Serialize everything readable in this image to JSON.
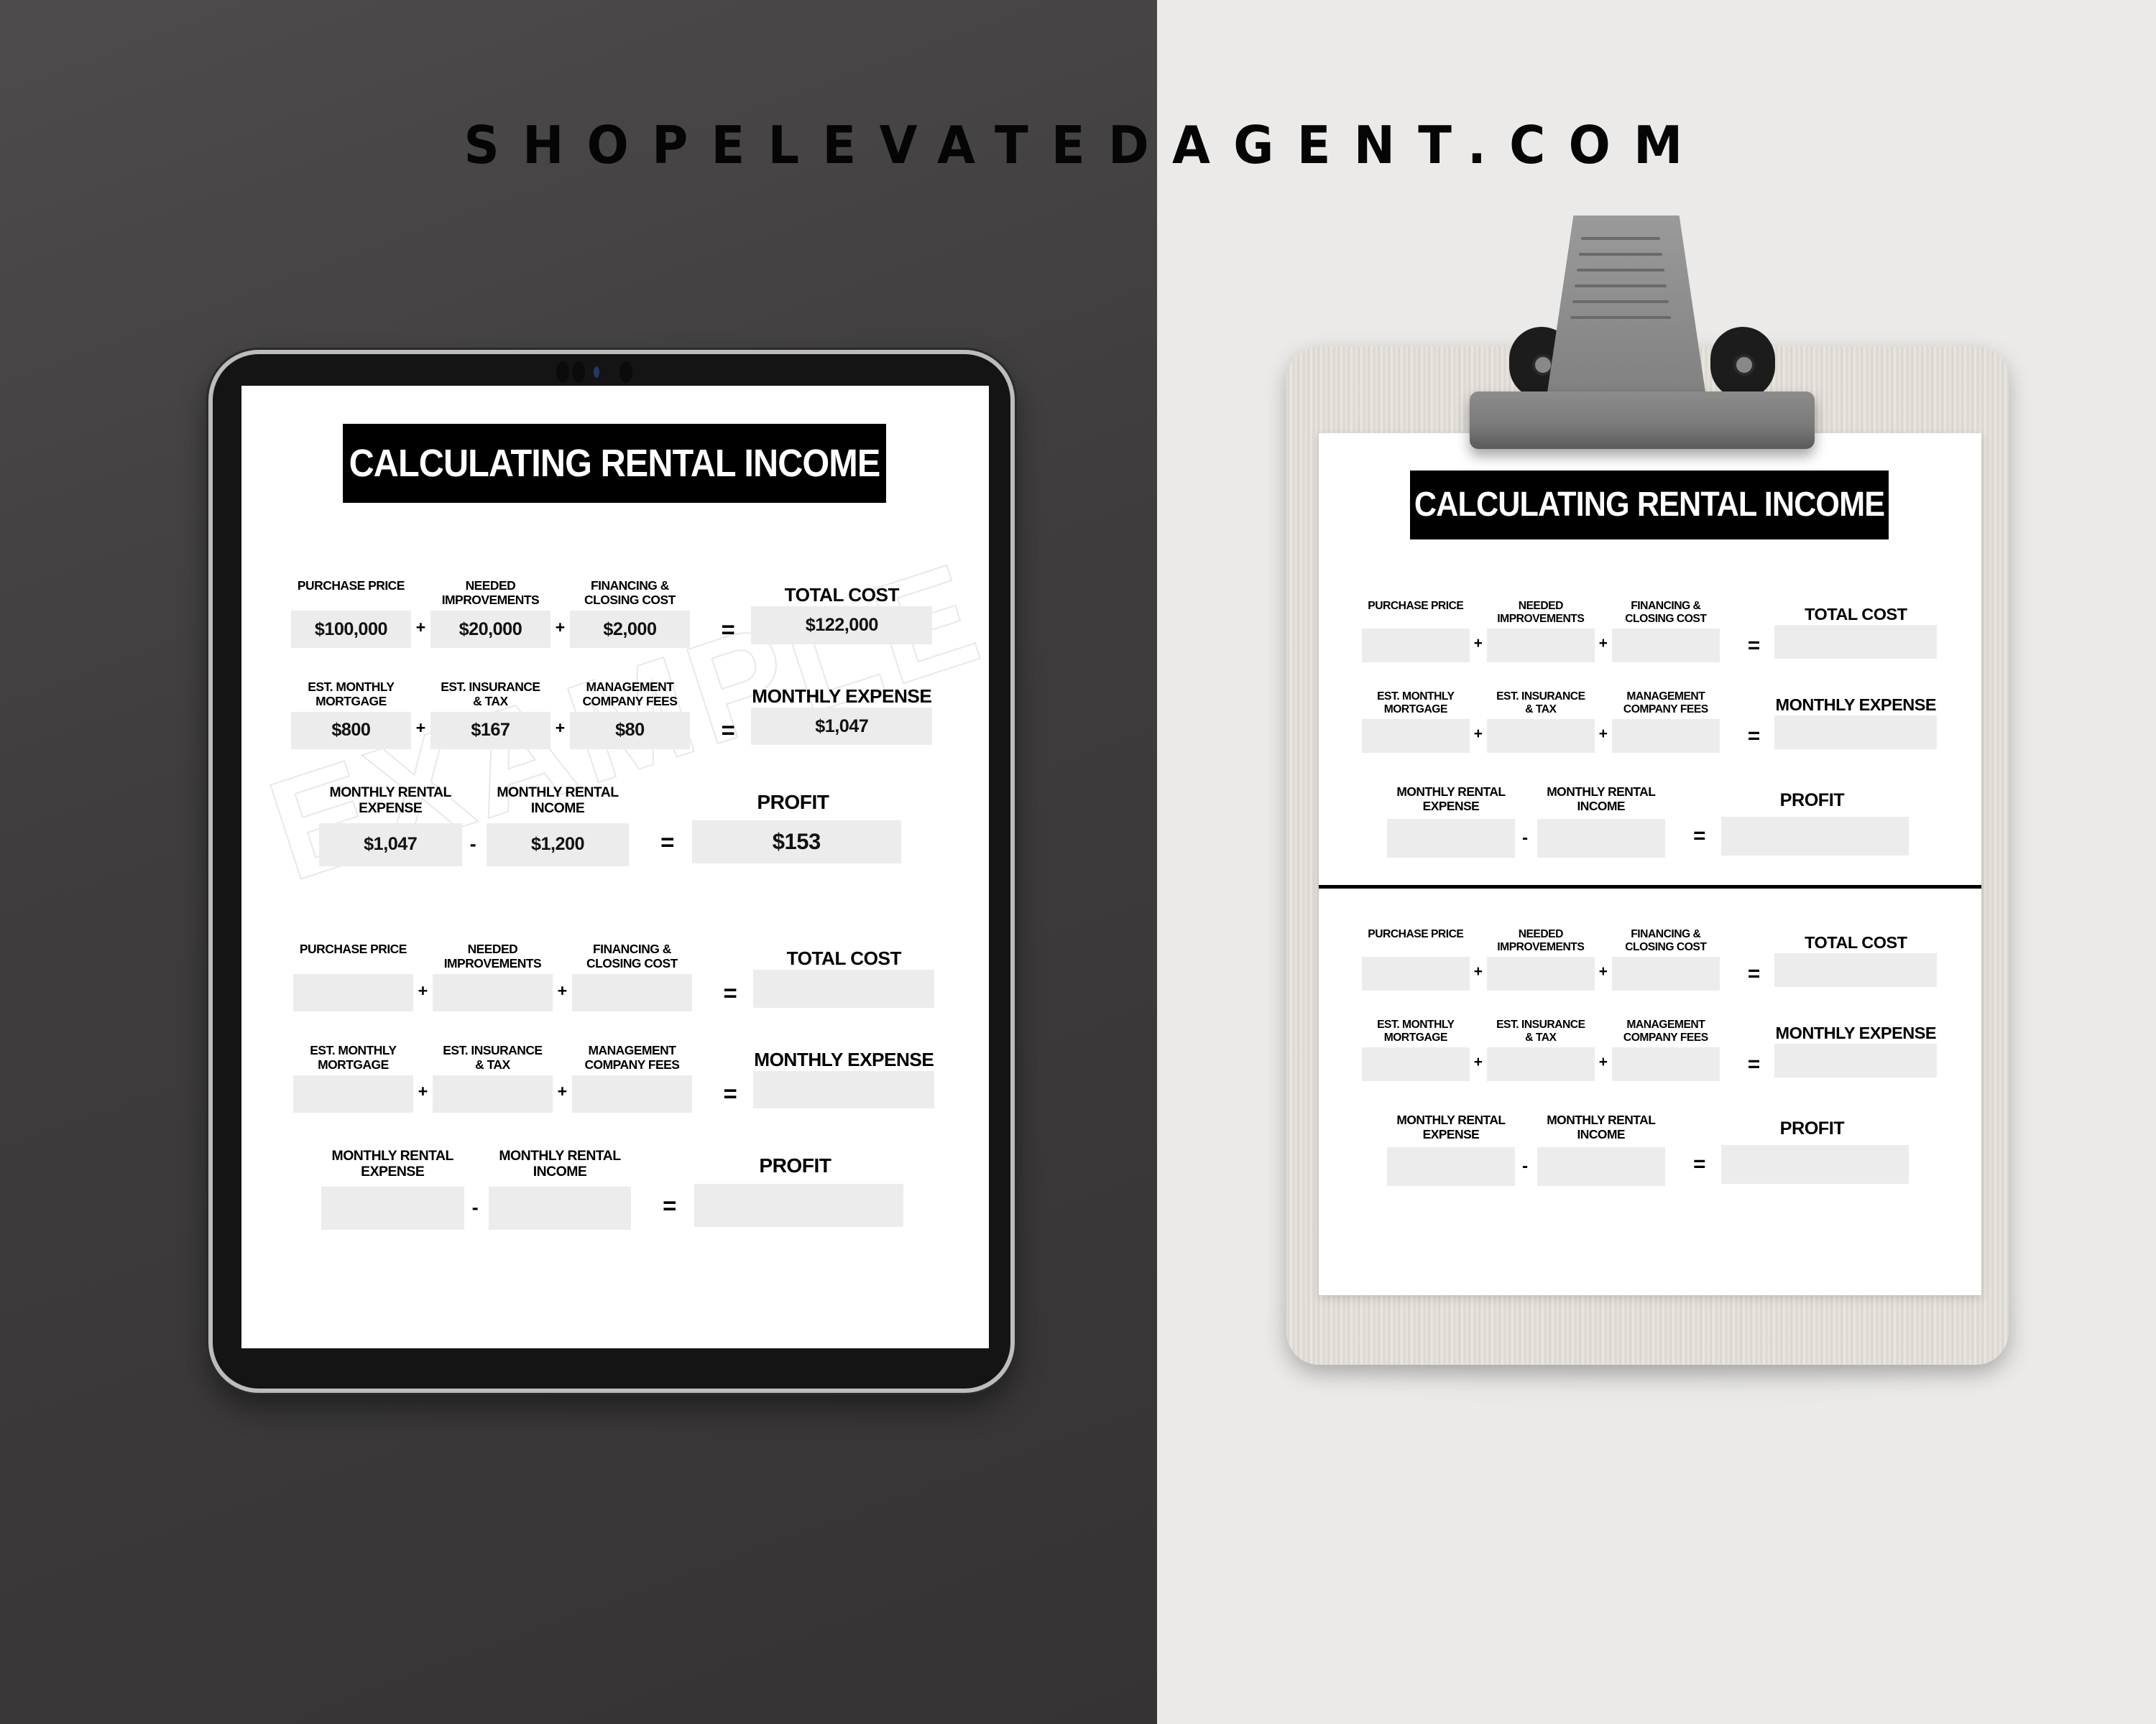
{
  "brand": {
    "text": "SHOPELEVATEDAGENT.COM"
  },
  "tablet_sheet": {
    "title": "CALCULATING RENTAL INCOME",
    "watermark": "EXAMPLE",
    "example": {
      "row1": {
        "labels": [
          "PURCHASE PRICE",
          "NEEDED\nIMPROVEMENTS",
          "FINANCING &\nCLOSING COST"
        ],
        "result_label": "TOTAL COST",
        "values": [
          "$100,000",
          "$20,000",
          "$2,000"
        ],
        "ops": [
          "+",
          "+",
          "="
        ],
        "result": "$122,000"
      },
      "row2": {
        "labels": [
          "EST. MONTHLY\nMORTGAGE",
          "EST.  INSURANCE\n& TAX",
          "MANAGEMENT\nCOMPANY FEES"
        ],
        "result_label": "MONTHLY EXPENSE",
        "values": [
          "$800",
          "$167",
          "$80"
        ],
        "ops": [
          "+",
          "+",
          "="
        ],
        "result": "$1,047"
      },
      "row3": {
        "labels": [
          "MONTHLY RENTAL\nEXPENSE",
          "MONTHLY RENTAL\nINCOME"
        ],
        "result_label": "PROFIT",
        "values": [
          "$1,047",
          "$1,200"
        ],
        "ops": [
          "-",
          "="
        ],
        "result": "$153"
      }
    },
    "blank": {
      "row1": {
        "labels": [
          "PURCHASE PRICE",
          "NEEDED\nIMPROVEMENTS",
          "FINANCING &\nCLOSING COST"
        ],
        "result_label": "TOTAL COST",
        "ops": [
          "+",
          "+",
          "="
        ]
      },
      "row2": {
        "labels": [
          "EST. MONTHLY\nMORTGAGE",
          "EST.  INSURANCE\n& TAX",
          "MANAGEMENT\nCOMPANY FEES"
        ],
        "result_label": "MONTHLY EXPENSE",
        "ops": [
          "+",
          "+",
          "="
        ]
      },
      "row3": {
        "labels": [
          "MONTHLY RENTAL\nEXPENSE",
          "MONTHLY RENTAL\nINCOME"
        ],
        "result_label": "PROFIT",
        "ops": [
          "-",
          "="
        ]
      }
    }
  },
  "clipboard_sheet": {
    "title": "CALCULATING RENTAL INCOME",
    "sections": [
      {
        "row1": {
          "labels": [
            "PURCHASE PRICE",
            "NEEDED\nIMPROVEMENTS",
            "FINANCING &\nCLOSING COST"
          ],
          "result_label": "TOTAL COST",
          "ops": [
            "+",
            "+",
            "="
          ]
        },
        "row2": {
          "labels": [
            "EST. MONTHLY\nMORTGAGE",
            "EST.  INSURANCE\n& TAX",
            "MANAGEMENT\nCOMPANY FEES"
          ],
          "result_label": "MONTHLY EXPENSE",
          "ops": [
            "+",
            "+",
            "="
          ]
        },
        "row3": {
          "labels": [
            "MONTHLY RENTAL\nEXPENSE",
            "MONTHLY RENTAL\nINCOME"
          ],
          "result_label": "PROFIT",
          "ops": [
            "-",
            "="
          ]
        }
      },
      {
        "row1": {
          "labels": [
            "PURCHASE PRICE",
            "NEEDED\nIMPROVEMENTS",
            "FINANCING &\nCLOSING COST"
          ],
          "result_label": "TOTAL COST",
          "ops": [
            "+",
            "+",
            "="
          ]
        },
        "row2": {
          "labels": [
            "EST. MONTHLY\nMORTGAGE",
            "EST.  INSURANCE\n& TAX",
            "MANAGEMENT\nCOMPANY FEES"
          ],
          "result_label": "MONTHLY EXPENSE",
          "ops": [
            "+",
            "+",
            "="
          ]
        },
        "row3": {
          "labels": [
            "MONTHLY RENTAL\nEXPENSE",
            "MONTHLY RENTAL\nINCOME"
          ],
          "result_label": "PROFIT",
          "ops": [
            "-",
            "="
          ]
        }
      }
    ]
  }
}
